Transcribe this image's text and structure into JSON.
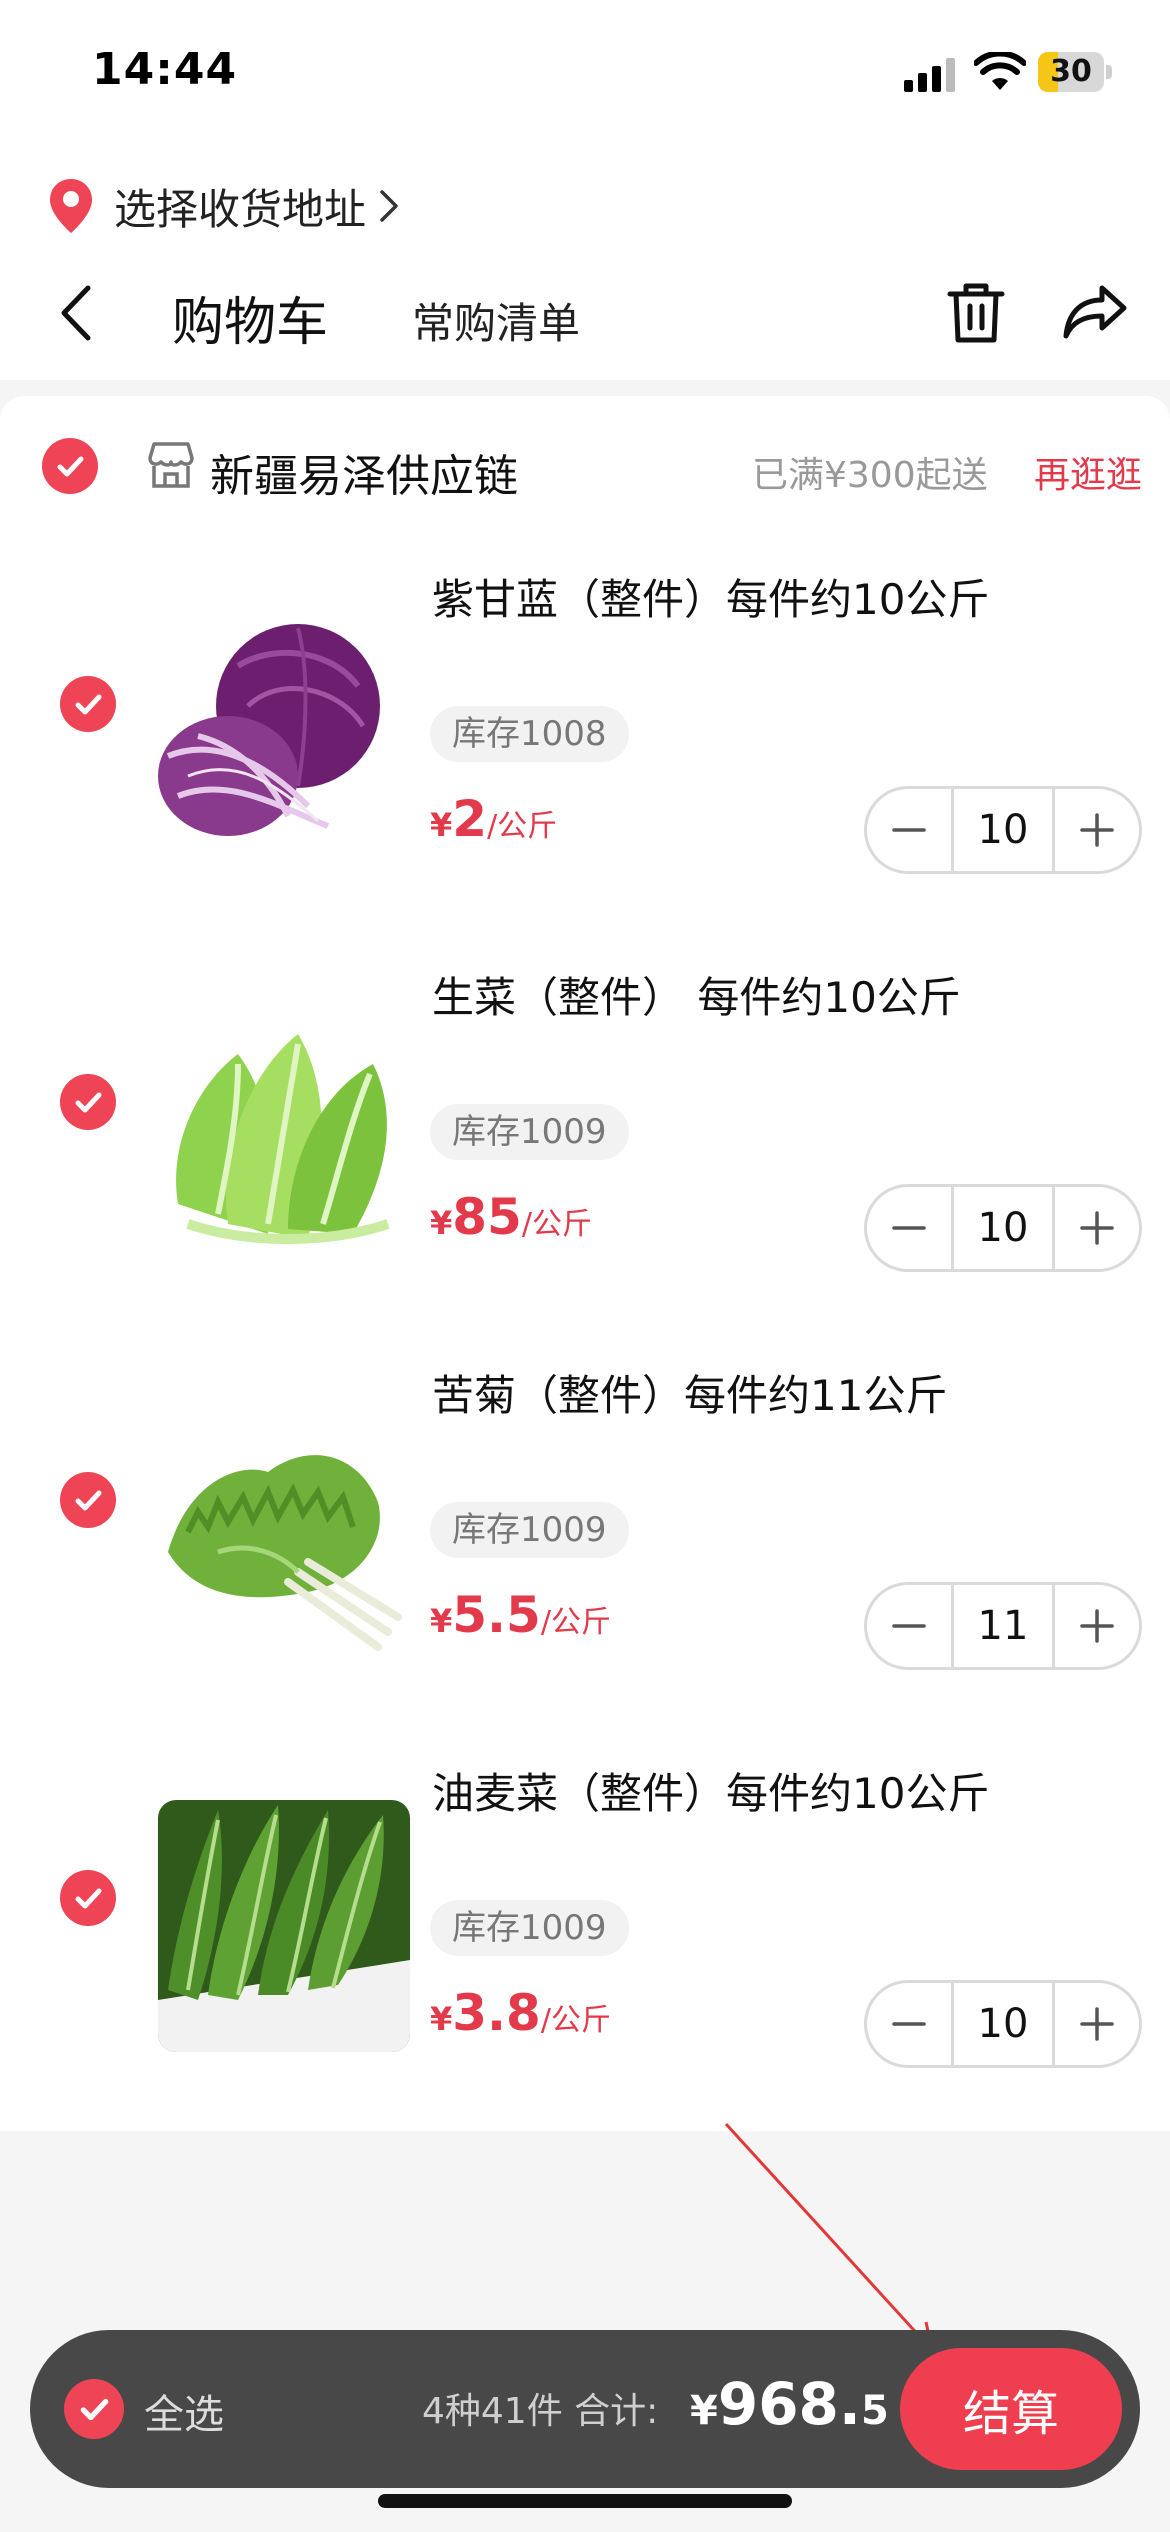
{
  "status_bar": {
    "time": "14:44",
    "battery": "30",
    "battery_level": 0.3
  },
  "header": {
    "address_label": "选择收货地址",
    "title": "购物车",
    "tab_label": "常购清单"
  },
  "store": {
    "name": "新疆易泽供应链",
    "min_order": "已满¥300起送",
    "more_link": "再逛逛"
  },
  "items": [
    {
      "name": "紫甘蓝（整件）每件约10公斤",
      "stock": "库存1008",
      "currency": "¥",
      "price": "2",
      "unit": "/公斤",
      "qty": "10",
      "image_icon": "purple-cabbage"
    },
    {
      "name": "生菜（整件） 每件约10公斤",
      "stock": "库存1009",
      "currency": "¥",
      "price": "85",
      "unit": "/公斤",
      "qty": "10",
      "image_icon": "lettuce"
    },
    {
      "name": "苦菊（整件）每件约11公斤",
      "stock": "库存1009",
      "currency": "¥",
      "price": "5.5",
      "unit": "/公斤",
      "qty": "11",
      "image_icon": "endive"
    },
    {
      "name": "油麦菜（整件）每件约10公斤",
      "stock": "库存1009",
      "currency": "¥",
      "price": "3.8",
      "unit": "/公斤",
      "qty": "10",
      "image_icon": "romaine-lettuce"
    }
  ],
  "stepper": {
    "minus": "−",
    "plus": "+"
  },
  "footer": {
    "select_all": "全选",
    "summary": "4种41件 合计:",
    "total_currency": "¥",
    "total_int": "968.",
    "total_dec": "5",
    "checkout": "结算"
  },
  "colors": {
    "accent": "#ef3e4f",
    "price": "#e33a4b",
    "bar": "#484848"
  }
}
